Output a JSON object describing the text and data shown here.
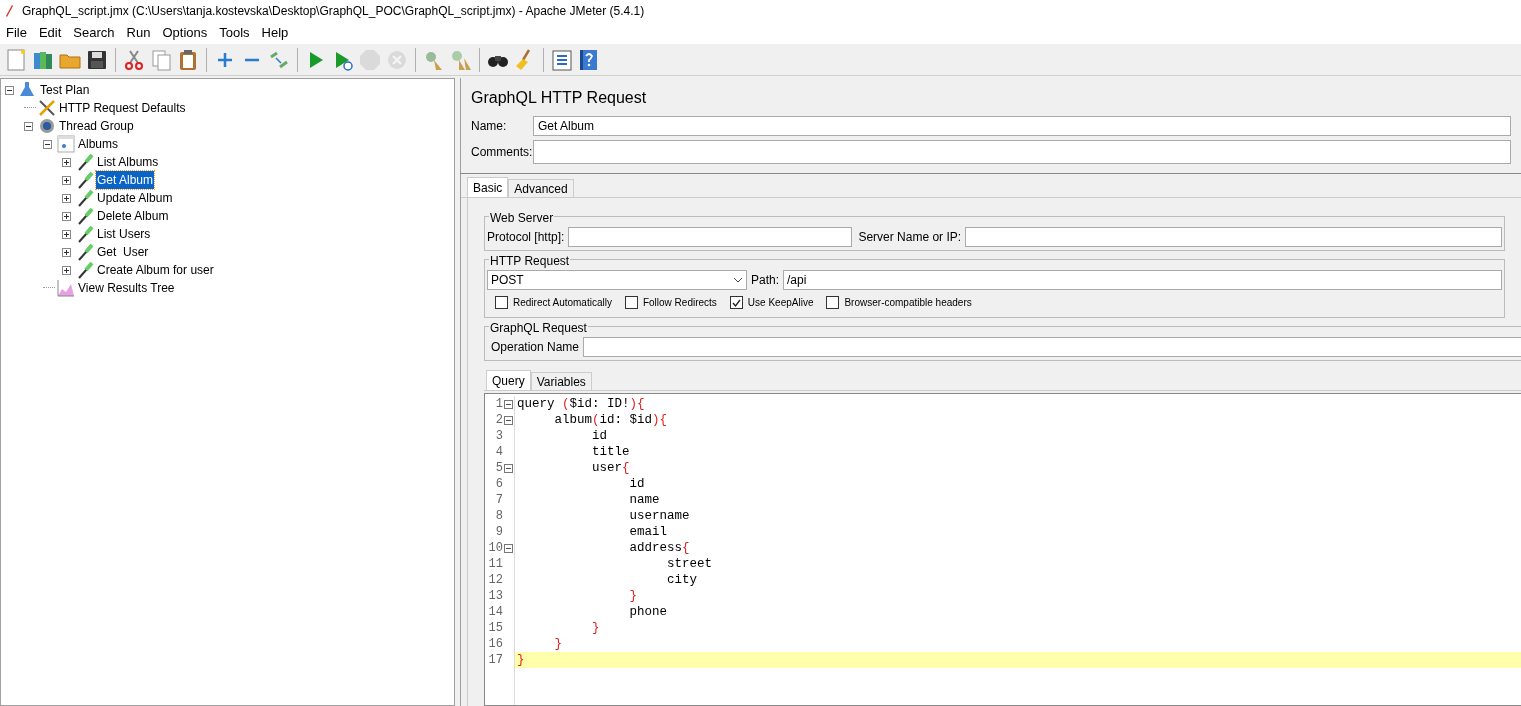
{
  "window": {
    "title": "GraphQL_script.jmx (C:\\Users\\tanja.kostevska\\Desktop\\GraphQL_POC\\GraphQL_script.jmx) - Apache JMeter (5.4.1)"
  },
  "menu": [
    "File",
    "Edit",
    "Search",
    "Run",
    "Options",
    "Tools",
    "Help"
  ],
  "toolbar": [
    {
      "kind": "new",
      "disabled": false
    },
    {
      "kind": "templates",
      "disabled": false
    },
    {
      "kind": "open",
      "disabled": false
    },
    {
      "kind": "save",
      "disabled": false
    },
    {
      "kind": "sep"
    },
    {
      "kind": "cut",
      "disabled": false
    },
    {
      "kind": "copy",
      "disabled": false
    },
    {
      "kind": "paste",
      "disabled": false
    },
    {
      "kind": "sep"
    },
    {
      "kind": "expand",
      "disabled": false
    },
    {
      "kind": "collapse",
      "disabled": false
    },
    {
      "kind": "toggle",
      "disabled": false
    },
    {
      "kind": "sep"
    },
    {
      "kind": "start",
      "disabled": false
    },
    {
      "kind": "start-no-pauses",
      "disabled": false
    },
    {
      "kind": "stop",
      "disabled": true
    },
    {
      "kind": "shutdown",
      "disabled": true
    },
    {
      "kind": "sep"
    },
    {
      "kind": "clear",
      "disabled": false
    },
    {
      "kind": "clear-all",
      "disabled": false
    },
    {
      "kind": "sep"
    },
    {
      "kind": "search",
      "disabled": false
    },
    {
      "kind": "reset-search",
      "disabled": false
    },
    {
      "kind": "sep"
    },
    {
      "kind": "function-helper",
      "disabled": false
    },
    {
      "kind": "help",
      "disabled": false
    }
  ],
  "tree": [
    {
      "label": "Test Plan",
      "kind": "flask",
      "expanded": true,
      "selected": false,
      "children": [
        {
          "label": "HTTP Request Defaults",
          "kind": "tools",
          "selected": false
        },
        {
          "label": "Thread Group",
          "kind": "gear",
          "expanded": true,
          "selected": false,
          "children": [
            {
              "label": "Albums",
              "kind": "controller",
              "expanded": true,
              "selected": false,
              "children": [
                {
                  "label": "List Albums",
                  "kind": "pipette",
                  "expanded": false,
                  "selected": false
                },
                {
                  "label": "Get Album",
                  "kind": "pipette",
                  "expanded": false,
                  "selected": true
                },
                {
                  "label": "Update Album",
                  "kind": "pipette",
                  "expanded": false,
                  "selected": false
                },
                {
                  "label": "Delete Album",
                  "kind": "pipette",
                  "expanded": false,
                  "selected": false
                },
                {
                  "label": "List Users",
                  "kind": "pipette",
                  "expanded": false,
                  "selected": false
                },
                {
                  "label": "Get  User",
                  "kind": "pipette",
                  "expanded": false,
                  "selected": false
                },
                {
                  "label": "Create Album for user",
                  "kind": "pipette",
                  "expanded": false,
                  "selected": false
                }
              ]
            },
            {
              "label": "View Results Tree",
              "kind": "chart",
              "selected": false
            }
          ]
        }
      ]
    }
  ],
  "panel": {
    "title": "GraphQL HTTP Request",
    "name": {
      "label": "Name:",
      "value": "Get Album"
    },
    "comments": {
      "label": "Comments:"
    },
    "tabs": [
      {
        "label": "Basic",
        "selected": true
      },
      {
        "label": "Advanced",
        "selected": false
      }
    ],
    "web_server": {
      "legend": "Web Server",
      "protocol_label": "Protocol [http]:",
      "server_label": "Server Name or IP:"
    },
    "http_request": {
      "legend": "HTTP Request",
      "method": "POST",
      "path_label": "Path:",
      "path": "/api",
      "options": [
        {
          "label": "Redirect Automatically",
          "checked": false
        },
        {
          "label": "Follow Redirects",
          "checked": false
        },
        {
          "label": "Use KeepAlive",
          "checked": true
        },
        {
          "label": "Browser-compatible headers",
          "checked": false
        }
      ]
    },
    "graphql": {
      "legend": "GraphQL Request",
      "operation_label": "Operation Name"
    },
    "query_tabs": [
      {
        "label": "Query",
        "selected": true
      },
      {
        "label": "Variables",
        "selected": false
      }
    ],
    "editor": {
      "lines": [
        {
          "number": "1",
          "text": "query ($id: ID!){",
          "foldable": true,
          "current": false
        },
        {
          "number": "2",
          "text": "     album(id: $id){",
          "foldable": true,
          "current": false
        },
        {
          "number": "3",
          "text": "          id",
          "foldable": false,
          "current": false
        },
        {
          "number": "4",
          "text": "          title",
          "foldable": false,
          "current": false
        },
        {
          "number": "5",
          "text": "          user{",
          "foldable": true,
          "current": false
        },
        {
          "number": "6",
          "text": "               id",
          "foldable": false,
          "current": false
        },
        {
          "number": "7",
          "text": "               name",
          "foldable": false,
          "current": false
        },
        {
          "number": "8",
          "text": "               username",
          "foldable": false,
          "current": false
        },
        {
          "number": "9",
          "text": "               email",
          "foldable": false,
          "current": false
        },
        {
          "number": "10",
          "text": "               address{",
          "foldable": true,
          "current": false
        },
        {
          "number": "11",
          "text": "                    street",
          "foldable": false,
          "current": false
        },
        {
          "number": "12",
          "text": "                    city",
          "foldable": false,
          "current": false
        },
        {
          "number": "13",
          "text": "               }",
          "foldable": false,
          "current": false
        },
        {
          "number": "14",
          "text": "               phone",
          "foldable": false,
          "current": false
        },
        {
          "number": "15",
          "text": "          }",
          "foldable": false,
          "current": false
        },
        {
          "number": "16",
          "text": "     }",
          "foldable": false,
          "current": false
        },
        {
          "number": "17",
          "text": "}",
          "foldable": false,
          "current": true
        }
      ]
    }
  }
}
